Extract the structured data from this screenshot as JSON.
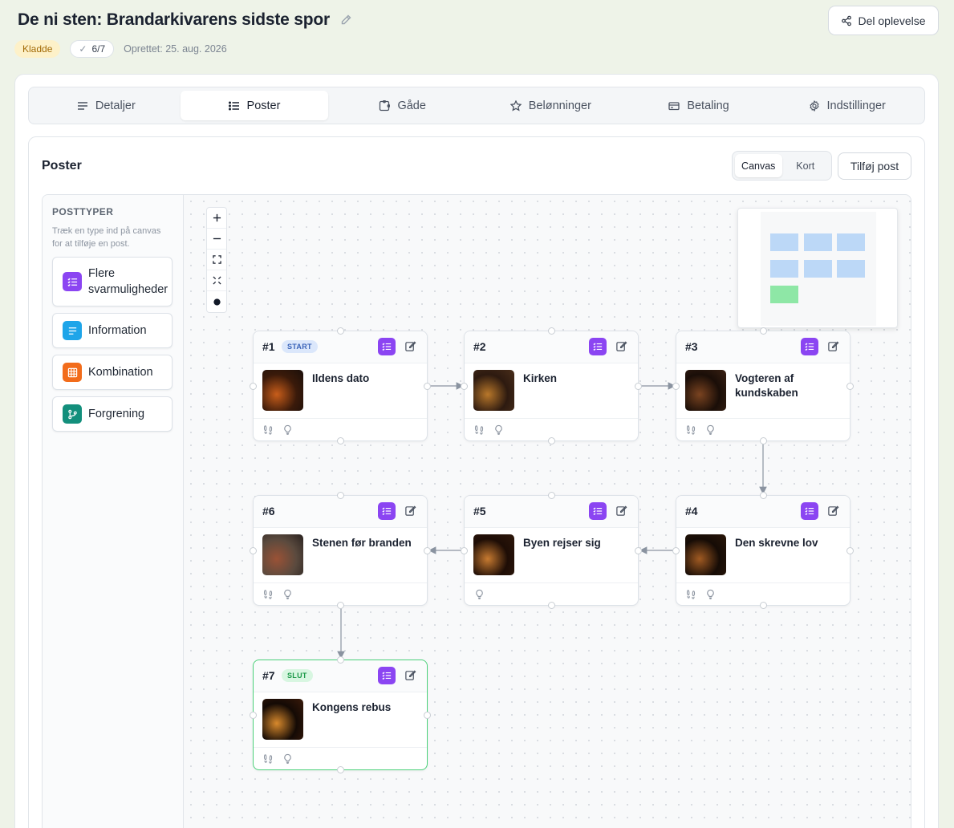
{
  "header": {
    "title": "De ni sten: Brandarkivarens sidste spor",
    "status_badge": "Kladde",
    "progress": "6/7",
    "created": "Oprettet: 25. aug. 2026",
    "share_label": "Del oplevelse"
  },
  "tabs": [
    {
      "label": "Detaljer",
      "icon": "lines-icon",
      "active": false
    },
    {
      "label": "Poster",
      "icon": "list-icon",
      "active": true
    },
    {
      "label": "Gåde",
      "icon": "puzzle-icon",
      "active": false
    },
    {
      "label": "Belønninger",
      "icon": "star-icon",
      "active": false
    },
    {
      "label": "Betaling",
      "icon": "card-icon",
      "active": false
    },
    {
      "label": "Indstillinger",
      "icon": "gear-icon",
      "active": false
    }
  ],
  "posts_section": {
    "title": "Poster",
    "view_toggle": {
      "options": [
        "Canvas",
        "Kort"
      ],
      "selected": "Canvas"
    },
    "add_label": "Tilføj post"
  },
  "palette": {
    "heading": "POSTTYPER",
    "hint": "Træk en type ind på canvas for at tilføje en post.",
    "items": [
      {
        "label": "Flere svarmuligheder",
        "icon": "checklist-icon",
        "color": "#8b45f2"
      },
      {
        "label": "Information",
        "icon": "text-icon",
        "color": "#1ea5e9"
      },
      {
        "label": "Kombination",
        "icon": "grid-icon",
        "color": "#f26c1b"
      },
      {
        "label": "Forgrening",
        "icon": "branch-icon",
        "color": "#138f7c"
      }
    ]
  },
  "nodes": [
    {
      "num": "#1",
      "badge": "START",
      "name": "Ildens dato",
      "footer_icons": [
        "footprints-icon",
        "lightbulb-icon"
      ],
      "image_palette": [
        "#3a1a0a",
        "#c85d1a",
        "#1a0f0a"
      ]
    },
    {
      "num": "#2",
      "badge": "",
      "name": "Kirken",
      "footer_icons": [
        "footprints-icon",
        "lightbulb-icon"
      ],
      "image_palette": [
        "#2d1a10",
        "#b8772a",
        "#4a2e1a"
      ]
    },
    {
      "num": "#3",
      "badge": "",
      "name": "Vogteren af kundskaben",
      "footer_icons": [
        "footprints-icon",
        "lightbulb-icon"
      ],
      "image_palette": [
        "#1a0e08",
        "#7a4320",
        "#3b2214"
      ]
    },
    {
      "num": "#4",
      "badge": "",
      "name": "Den skrevne lov",
      "footer_icons": [
        "footprints-icon",
        "lightbulb-icon"
      ],
      "image_palette": [
        "#160c06",
        "#a05a22",
        "#2a1709"
      ]
    },
    {
      "num": "#5",
      "badge": "",
      "name": "Byen rejser sig",
      "footer_icons": [
        "lightbulb-icon"
      ],
      "image_palette": [
        "#1e0d06",
        "#c77a30",
        "#2e170a"
      ]
    },
    {
      "num": "#6",
      "badge": "",
      "name": "Stenen før branden",
      "footer_icons": [
        "footprints-icon",
        "lightbulb-icon"
      ],
      "image_palette": [
        "#5a4a3e",
        "#9a5236",
        "#2a2220"
      ]
    },
    {
      "num": "#7",
      "badge": "SLUT",
      "name": "Kongens rebus",
      "footer_icons": [
        "footprints-icon",
        "lightbulb-icon"
      ],
      "image_palette": [
        "#140a05",
        "#d8892c",
        "#3a1a0a"
      ]
    }
  ],
  "colors": {
    "accent": "#8b45f2",
    "start_badge": "#3a63b8",
    "end_badge": "#1e9a4a",
    "end_border": "#4cd17a",
    "minimap_node": "#bcd8f7",
    "minimap_end": "#8ee7a6"
  }
}
